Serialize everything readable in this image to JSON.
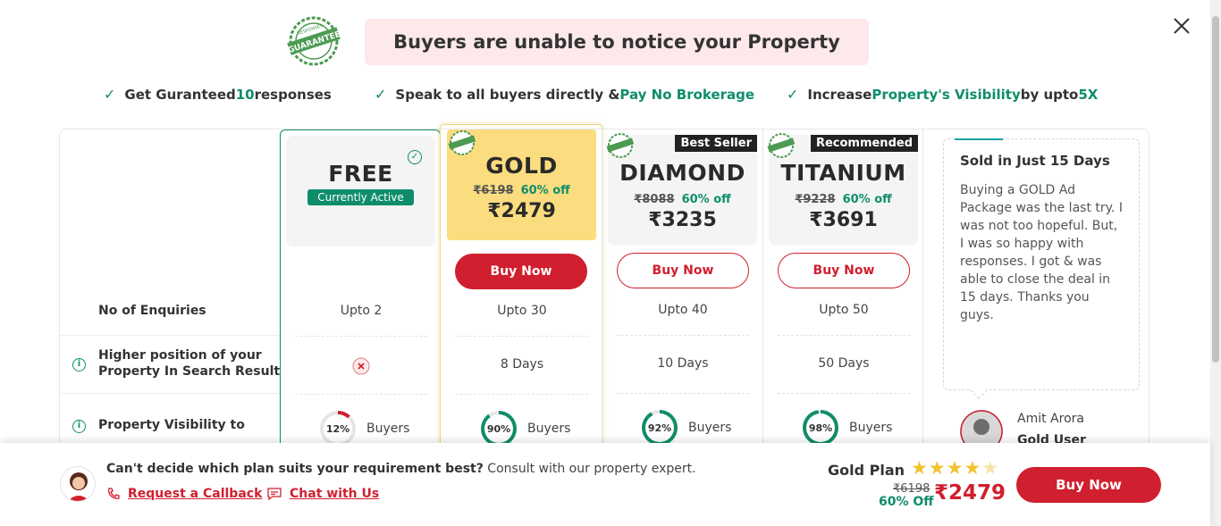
{
  "header": {
    "seal_text_top": "RESPONSES",
    "seal_text_main": "GUARANTEE",
    "headline": "Buyers are unable to notice your Property"
  },
  "benefits": [
    {
      "pre": "Get Guranteed ",
      "highlight": "10",
      "post": " responses"
    },
    {
      "pre": "Speak to all buyers directly & ",
      "highlight": "Pay No Brokerage",
      "post": ""
    },
    {
      "pre": "Increase ",
      "highlight": "Property's Visibility",
      "post": " by upto ",
      "highlight2": "5X"
    }
  ],
  "features": [
    {
      "label": "No of Enquiries"
    },
    {
      "label_line1": "Higher position of your",
      "label_line2": "Property In Search Result"
    },
    {
      "label": "Property Visibility to"
    }
  ],
  "plans": {
    "free": {
      "name": "FREE",
      "badge": "Currently Active",
      "enquiries": "Upto 2",
      "search_position": "not-included",
      "visibility_pct": 12,
      "visibility_label": "12%",
      "buyers": "Buyers"
    },
    "gold": {
      "name": "GOLD",
      "old_price": "₹6198",
      "off": "60% off",
      "price": "₹2479",
      "buy": "Buy Now",
      "enquiries": "Upto 30",
      "search_position": "8 Days",
      "visibility_pct": 90,
      "visibility_label": "90%",
      "buyers": "Buyers"
    },
    "diamond": {
      "name": "DIAMOND",
      "ribbon": "Best Seller",
      "old_price": "₹8088",
      "off": "60% off",
      "price": "₹3235",
      "buy": "Buy Now",
      "enquiries": "Upto 40",
      "search_position": "10 Days",
      "visibility_pct": 92,
      "visibility_label": "92%",
      "buyers": "Buyers"
    },
    "titanium": {
      "name": "TITANIUM",
      "ribbon": "Recommended",
      "old_price": "₹9228",
      "off": "60% off",
      "price": "₹3691",
      "buy": "Buy Now",
      "enquiries": "Upto 50",
      "search_position": "50 Days",
      "visibility_pct": 98,
      "visibility_label": "98%",
      "buyers": "Buyers"
    }
  },
  "testimonial": {
    "title": "Sold in Just 15 Days",
    "text": "Buying a GOLD Ad Package was the last try. I was not too hopeful. But, I was so happy with responses. I got & was able to close the deal in 15 days. Thanks you guys.",
    "user_name": "Amit Arora",
    "user_role": "Gold User"
  },
  "bottom_bar": {
    "question": "Can't decide which plan suits your requirement best?",
    "consult": " Consult with our property expert.",
    "callback": "Request a Callback",
    "chat": "Chat with Us",
    "plan_label": "Gold Plan",
    "rating": 4,
    "rating_max": 5,
    "old_price": "₹6198",
    "off": "60% Off",
    "price": "₹2479",
    "buy": "Buy Now"
  },
  "colors": {
    "accent_red": "#d01f2e",
    "accent_green": "#0f8d6b",
    "gold_bg": "#fbdd7f",
    "headline_bg": "#fde8ea"
  }
}
